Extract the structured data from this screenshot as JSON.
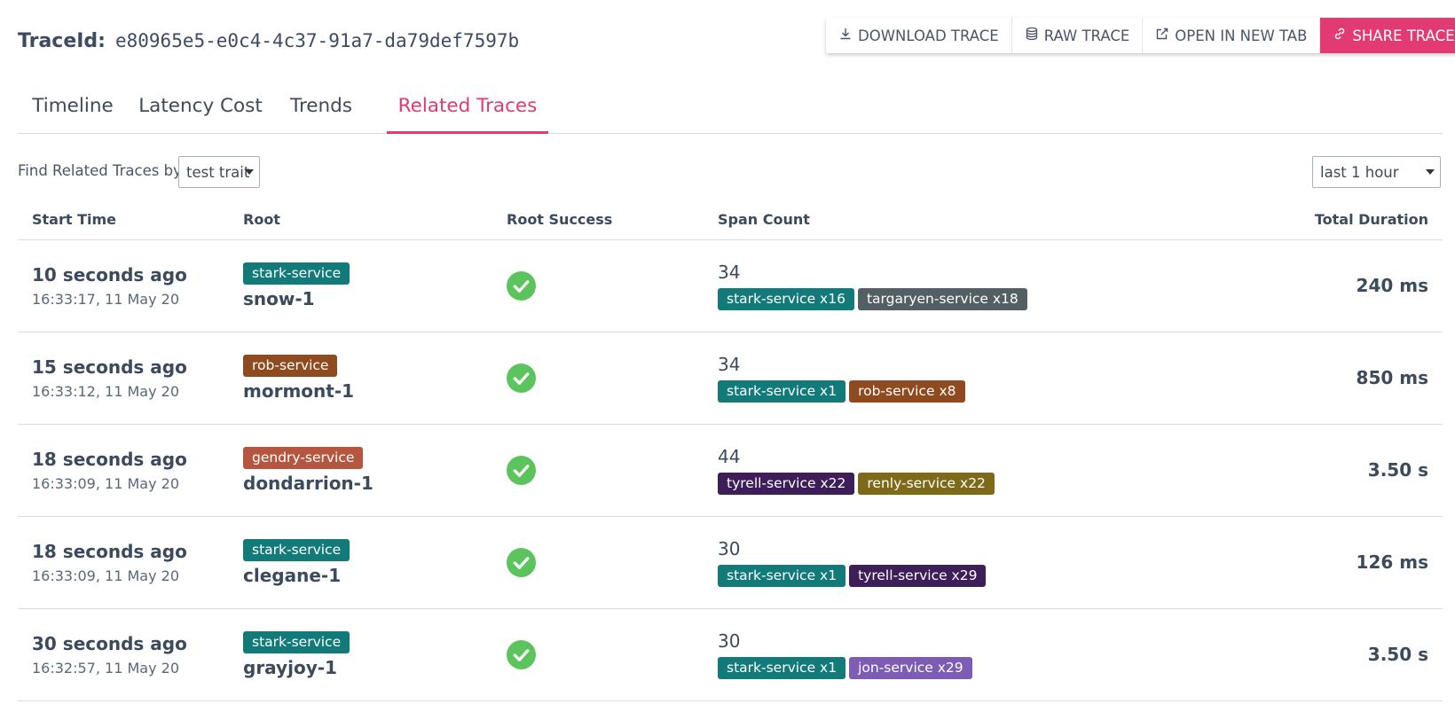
{
  "trace": {
    "label": "TraceId:",
    "id": "e80965e5-e0c4-4c37-91a7-da79def7597b"
  },
  "actions": [
    {
      "label": "DOWNLOAD TRACE",
      "icon": "download-icon"
    },
    {
      "label": "RAW TRACE",
      "icon": "database-icon"
    },
    {
      "label": "OPEN IN NEW TAB",
      "icon": "external-link-icon"
    },
    {
      "label": "SHARE TRACE",
      "icon": "link-icon"
    }
  ],
  "tabs": [
    {
      "label": "Timeline"
    },
    {
      "label": "Latency Cost"
    },
    {
      "label": "Trends"
    },
    {
      "label": "Related Traces",
      "active": true
    }
  ],
  "filter": {
    "label": "Find Related Traces by:",
    "selected": "test trait"
  },
  "timerange": {
    "selected": "last 1 hour"
  },
  "columns": [
    "Start Time",
    "Root",
    "Root Success",
    "Span Count",
    "Total Duration"
  ],
  "colors": {
    "accent": "#e23a72",
    "success": "#5cc45c",
    "stark-service": "#127b7a",
    "targaryen-service": "#535f63",
    "rob-service": "#8e4b1f",
    "gendry-service": "#b55640",
    "tyrell-service": "#3d1e59",
    "renly-service": "#7d6917",
    "jon-service": "#7d5cb5"
  },
  "rows": [
    {
      "ago": "10 seconds ago",
      "time": "16:33:17, 11 May 20",
      "service": "stark-service",
      "name": "snow-1",
      "success": true,
      "span_count": "34",
      "tags": [
        {
          "label": "stark-service x16",
          "service": "stark-service"
        },
        {
          "label": "targaryen-service x18",
          "service": "targaryen-service"
        }
      ],
      "duration": "240 ms"
    },
    {
      "ago": "15 seconds ago",
      "time": "16:33:12, 11 May 20",
      "service": "rob-service",
      "name": "mormont-1",
      "success": true,
      "span_count": "34",
      "tags": [
        {
          "label": "stark-service x1",
          "service": "stark-service"
        },
        {
          "label": "rob-service x8",
          "service": "rob-service"
        }
      ],
      "duration": "850 ms"
    },
    {
      "ago": "18 seconds ago",
      "time": "16:33:09, 11 May 20",
      "service": "gendry-service",
      "name": "dondarrion-1",
      "success": true,
      "span_count": "44",
      "tags": [
        {
          "label": "tyrell-service x22",
          "service": "tyrell-service"
        },
        {
          "label": "renly-service x22",
          "service": "renly-service"
        }
      ],
      "duration": "3.50 s"
    },
    {
      "ago": "18 seconds ago",
      "time": "16:33:09, 11 May 20",
      "service": "stark-service",
      "name": "clegane-1",
      "success": true,
      "span_count": "30",
      "tags": [
        {
          "label": "stark-service x1",
          "service": "stark-service"
        },
        {
          "label": "tyrell-service x29",
          "service": "tyrell-service"
        }
      ],
      "duration": "126 ms"
    },
    {
      "ago": "30 seconds ago",
      "time": "16:32:57, 11 May 20",
      "service": "stark-service",
      "name": "grayjoy-1",
      "success": true,
      "span_count": "30",
      "tags": [
        {
          "label": "stark-service x1",
          "service": "stark-service"
        },
        {
          "label": "jon-service x29",
          "service": "jon-service"
        }
      ],
      "duration": "3.50 s"
    }
  ]
}
